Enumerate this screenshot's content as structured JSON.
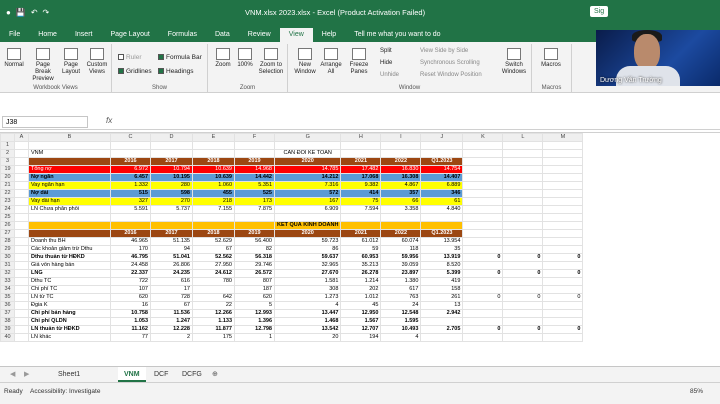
{
  "app": {
    "title": "VNM.xlsx 2023.xlsx  -  Excel (Product Activation Failed)",
    "signin": "Sig"
  },
  "ribbon_tabs": [
    "File",
    "Home",
    "Insert",
    "Page Layout",
    "Formulas",
    "Data",
    "Review",
    "View",
    "Help",
    "Tell me what you want to do"
  ],
  "ribbon": {
    "workbook_views": {
      "label": "Workbook Views",
      "buttons": [
        "Normal",
        "Page Break Preview",
        "Page Layout",
        "Custom Views"
      ]
    },
    "show": {
      "label": "Show",
      "items": [
        {
          "text": "Ruler",
          "checked": false
        },
        {
          "text": "Formula Bar",
          "checked": true
        },
        {
          "text": "Gridlines",
          "checked": true
        },
        {
          "text": "Headings",
          "checked": true
        }
      ]
    },
    "zoom": {
      "label": "Zoom",
      "buttons": [
        "Zoom",
        "100%",
        "Zoom to Selection"
      ]
    },
    "window": {
      "label": "Window",
      "buttons": [
        "New Window",
        "Arrange All",
        "Freeze Panes"
      ],
      "small": [
        "Split",
        "Hide",
        "Unhide",
        "View Side by Side",
        "Synchronous Scrolling",
        "Reset Window Position"
      ],
      "switch": "Switch Windows"
    },
    "macros": {
      "label": "Macros",
      "button": "Macros"
    }
  },
  "webcam": {
    "name": "Dương Văn Trường"
  },
  "formula_bar": {
    "name_box": "J38",
    "fx": "fx",
    "content": ""
  },
  "columns": [
    "A",
    "B",
    "C",
    "D",
    "E",
    "F",
    "G",
    "H",
    "I",
    "J",
    "K",
    "L",
    "M"
  ],
  "rows": [
    {
      "n": "1",
      "style": "",
      "cells": [
        "",
        "",
        "",
        "",
        "",
        "",
        "",
        "",
        "",
        "",
        "",
        "",
        ""
      ]
    },
    {
      "n": "2",
      "style": "",
      "cells": [
        "",
        "VNM",
        "",
        "",
        "",
        "",
        "CÂN ĐỐI KẾ TOÁN",
        "",
        "",
        "",
        "",
        "",
        ""
      ]
    },
    {
      "n": "3",
      "style": "brown",
      "cells": [
        "",
        "",
        "2016",
        "2017",
        "2018",
        "2019",
        "2020",
        "2021",
        "2022",
        "Q1.2023",
        "",
        "",
        ""
      ]
    },
    {
      "n": "19",
      "style": "red",
      "cells": [
        "",
        "Tổng nợ",
        "6.972",
        "10.794",
        "10.639",
        "14.968",
        "14.785",
        "17.482",
        "16.830",
        "14.754",
        "",
        "",
        ""
      ]
    },
    {
      "n": "20",
      "style": "blue",
      "cells": [
        "",
        "Nợ ngắn",
        "6.457",
        "10.195",
        "10.639",
        "14.442",
        "14.212",
        "17.068",
        "16.308",
        "14.407",
        "",
        "",
        ""
      ]
    },
    {
      "n": "21",
      "style": "yellow",
      "cells": [
        "",
        "Vay ngắn hạn",
        "1.332",
        "280",
        "1.060",
        "5.351",
        "7.316",
        "9.382",
        "4.867",
        "6.889",
        "",
        "",
        ""
      ]
    },
    {
      "n": "22",
      "style": "blue",
      "cells": [
        "",
        "Nợ dài",
        "515",
        "598",
        "455",
        "525",
        "572",
        "414",
        "357",
        "346",
        "",
        "",
        ""
      ]
    },
    {
      "n": "23",
      "style": "yellow",
      "cells": [
        "",
        "Vay dài hạn",
        "327",
        "270",
        "218",
        "173",
        "167",
        "75",
        "66",
        "61",
        "",
        "",
        ""
      ]
    },
    {
      "n": "24",
      "style": "",
      "cells": [
        "",
        "LN Chưa phân phối",
        "5.591",
        "5.737",
        "7.155",
        "7.875",
        "6.909",
        "7.594",
        "3.358",
        "4.840",
        "",
        "",
        ""
      ]
    },
    {
      "n": "25",
      "style": "",
      "cells": [
        "",
        "",
        "",
        "",
        "",
        "",
        "",
        "",
        "",
        "",
        "",
        "",
        ""
      ]
    },
    {
      "n": "26",
      "style": "gold",
      "cells": [
        "",
        "",
        "",
        "",
        "",
        "",
        "KẾT QUẢ KINH DOANH",
        "",
        "",
        "",
        "",
        "",
        ""
      ]
    },
    {
      "n": "27",
      "style": "brown",
      "cells": [
        "",
        "",
        "2016",
        "2017",
        "2018",
        "2019",
        "2020",
        "2021",
        "2022",
        "Q1.2023",
        "",
        "",
        ""
      ]
    },
    {
      "n": "28",
      "style": "",
      "cells": [
        "",
        "Doanh thu BH",
        "46.965",
        "51.135",
        "52.629",
        "56.400",
        "59.723",
        "61.012",
        "60.074",
        "13.954",
        "",
        "",
        ""
      ]
    },
    {
      "n": "29",
      "style": "",
      "cells": [
        "",
        "Các khoản giảm trừ Dthu",
        "170",
        "94",
        "67",
        "82",
        "86",
        "59",
        "118",
        "35",
        "",
        "",
        ""
      ]
    },
    {
      "n": "30",
      "style": "bold",
      "cells": [
        "",
        "Dthu thuần từ HĐKD",
        "46.795",
        "51.041",
        "52.562",
        "56.318",
        "59.637",
        "60.953",
        "59.956",
        "13.919",
        "0",
        "0",
        "0"
      ]
    },
    {
      "n": "31",
      "style": "",
      "cells": [
        "",
        "Giá vốn hàng bán",
        "24.458",
        "26.806",
        "27.950",
        "29.746",
        "32.965",
        "35.213",
        "39.059",
        "8.520",
        "",
        "",
        ""
      ]
    },
    {
      "n": "32",
      "style": "bold",
      "cells": [
        "",
        "LNG",
        "22.337",
        "24.235",
        "24.612",
        "26.572",
        "27.670",
        "26.278",
        "23.897",
        "5.399",
        "0",
        "0",
        "0"
      ]
    },
    {
      "n": "33",
      "style": "",
      "cells": [
        "",
        "Dthu TC",
        "722",
        "616",
        "780",
        "807",
        "1.581",
        "1.214",
        "1.380",
        "419",
        "",
        "",
        ""
      ]
    },
    {
      "n": "34",
      "style": "",
      "cells": [
        "",
        "Chi phí TC",
        "107",
        "17",
        "",
        "187",
        "308",
        "202",
        "617",
        "158",
        "",
        "",
        ""
      ]
    },
    {
      "n": "35",
      "style": "",
      "cells": [
        "",
        "LN từ TC",
        "620",
        "728",
        "642",
        "620",
        "1.273",
        "1.012",
        "763",
        "261",
        "0",
        "0",
        "0"
      ]
    },
    {
      "n": "36",
      "style": "",
      "cells": [
        "",
        "Đgia K",
        "16",
        "67",
        "22",
        "5",
        "4",
        "45",
        "24",
        "13",
        "",
        "",
        ""
      ]
    },
    {
      "n": "37",
      "style": "bold",
      "cells": [
        "",
        "Chi phí bán hàng",
        "10.758",
        "11.536",
        "12.266",
        "12.993",
        "13.447",
        "12.950",
        "12.548",
        "2.942",
        "",
        "",
        ""
      ]
    },
    {
      "n": "38",
      "style": "bold",
      "cells": [
        "",
        "Chi phí QLDN",
        "1.053",
        "1.247",
        "1.133",
        "1.396",
        "1.468",
        "1.567",
        "1.595",
        "",
        "",
        "",
        ""
      ]
    },
    {
      "n": "39",
      "style": "bold",
      "cells": [
        "",
        "LN thuần từ HĐKD",
        "11.162",
        "12.228",
        "11.877",
        "12.798",
        "13.542",
        "12.707",
        "10.493",
        "2.705",
        "0",
        "0",
        "0"
      ]
    },
    {
      "n": "40",
      "style": "",
      "cells": [
        "",
        "LN khác",
        "77",
        "2",
        "175",
        "1",
        "20",
        "194",
        "4",
        "",
        "",
        "",
        ""
      ]
    }
  ],
  "sheet_tabs": [
    "Sheet1",
    "VNM",
    "DCF",
    "DCFG"
  ],
  "active_sheet": "VNM",
  "status": {
    "ready": "Ready",
    "accessibility": "Accessibility: Investigate",
    "zoom": "85%"
  }
}
